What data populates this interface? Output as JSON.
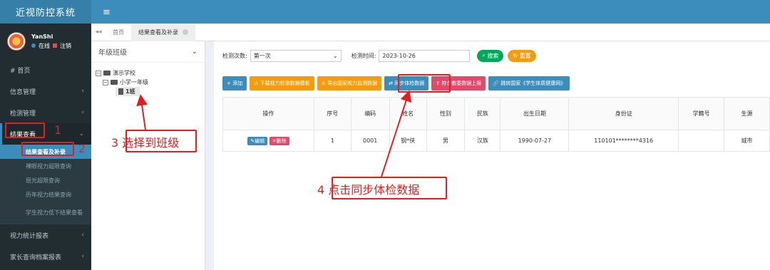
{
  "app": {
    "title": "近视防控系统"
  },
  "user": {
    "name": "YanShi",
    "status_online": "在线",
    "logout": "注销"
  },
  "menu": {
    "home": "首页",
    "info": "信息管理",
    "detect": "检测管理",
    "results": "结果查看",
    "results_sub": [
      "结果查看及补录",
      "裸眼视力超限查询",
      "屈光超限查询",
      "历年视力结果查询",
      "学生视力低下结果查看"
    ],
    "vision_report": "视力统计报表",
    "parent_report": "家长查询档案报表"
  },
  "tabs": {
    "home": "首页",
    "current": "结果查看及补录"
  },
  "tree": {
    "title": "年级班级",
    "school": "演示学校",
    "grade": "小学一年级",
    "class": "1班"
  },
  "search": {
    "count_label": "检测次数:",
    "count_value": "第一次",
    "time_label": "检测时间:",
    "time_value": "2023-10-26",
    "search_btn": "搜索",
    "reset_btn": "重置"
  },
  "toolbar": [
    "添加",
    "下载视力检测数据模板",
    "导出国家视力监测数据",
    "同步体检数据",
    "符合教委数据上报",
    "跳转国家《学生体质健康网》"
  ],
  "table": {
    "headers": [
      "操作",
      "序号",
      "编码",
      "姓名",
      "性别",
      "民族",
      "出生日期",
      "身份证",
      "学籍号",
      "生源"
    ],
    "edit_btn": "编辑",
    "delete_btn": "删除",
    "rows": [
      {
        "no": "1",
        "code": "0001",
        "name": "钢*侠",
        "gender": "男",
        "ethnicity": "汉族",
        "birth": "1990-07-27",
        "id_card": "110101********4316",
        "student_no": "",
        "source": "城市"
      }
    ]
  },
  "annotations": {
    "n1": "1",
    "n2": "2",
    "step3": "3 选择到班级",
    "step4": "4 点击同步体检数据"
  },
  "colors": {
    "sidebar": "#222d32",
    "header": "#3c8dbc",
    "annotation": "#e02020"
  }
}
